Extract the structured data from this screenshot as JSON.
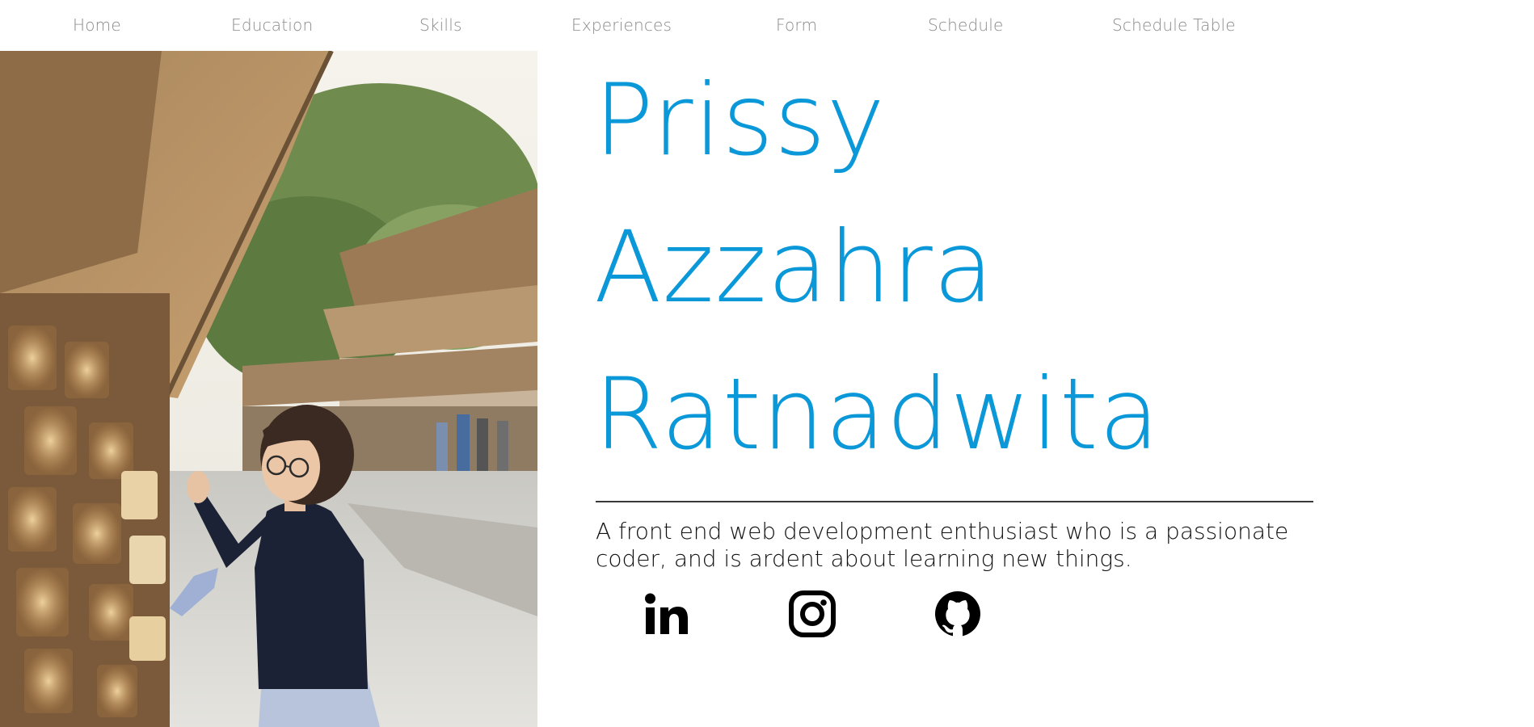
{
  "nav": {
    "items": [
      {
        "label": "Home"
      },
      {
        "label": "Education"
      },
      {
        "label": "Skills"
      },
      {
        "label": "Experiences"
      },
      {
        "label": "Form"
      },
      {
        "label": "Schedule"
      },
      {
        "label": "Schedule Table"
      }
    ]
  },
  "hero": {
    "name_lines": [
      "Prissy",
      "Azzahra",
      "Ratnadwita"
    ],
    "tagline": "A front end web development enthusiast who is a passionate coder, and is ardent about learning new things.",
    "photo_icon": "portrait-photo"
  },
  "social": [
    {
      "icon": "linkedin-icon"
    },
    {
      "icon": "instagram-icon"
    },
    {
      "icon": "github-icon"
    }
  ],
  "colors": {
    "accent": "#0a98d8",
    "nav_text": "#8a8a8a",
    "body_text": "#111111",
    "background": "#ffffff"
  }
}
